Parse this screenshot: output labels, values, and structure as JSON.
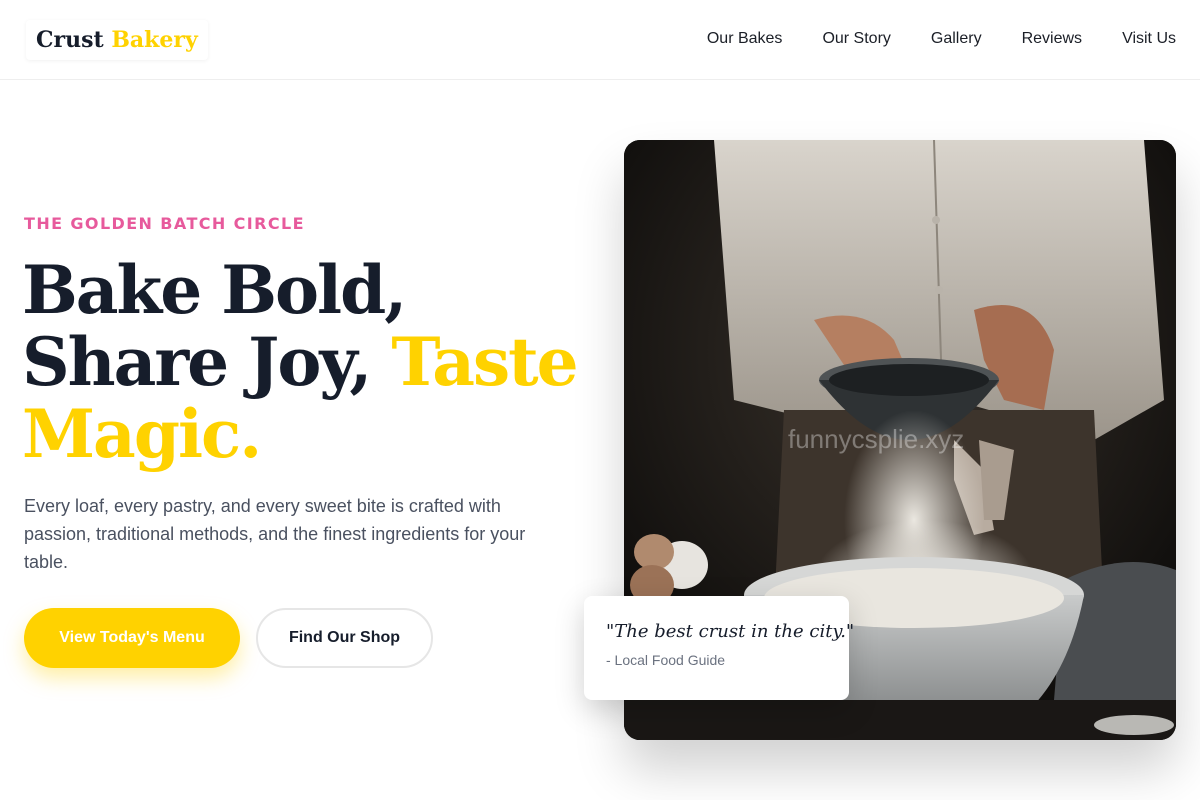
{
  "header": {
    "logo": {
      "part1": "Crust",
      "part2": "Bakery"
    },
    "nav": [
      {
        "label": "Our Bakes"
      },
      {
        "label": "Our Story"
      },
      {
        "label": "Gallery"
      },
      {
        "label": "Reviews"
      },
      {
        "label": "Visit Us"
      }
    ]
  },
  "hero": {
    "eyebrow": "THE GOLDEN BATCH CIRCLE",
    "headline": {
      "line1": "Bake Bold,",
      "line2a": "Share Joy,",
      "line2b": "Taste",
      "line3": "Magic."
    },
    "lede": "Every loaf, every pastry, and every sweet bite is crafted with passion, traditional methods, and the finest ingredients for your table.",
    "primary_cta": "View Today's Menu",
    "secondary_cta": "Find Our Shop",
    "image_watermark": "funnycsplie.xyz",
    "quote": {
      "text": "\"The best crust in the city.\"",
      "source": "- Local Food Guide"
    }
  },
  "colors": {
    "accent": "#ffd200",
    "eyebrow": "#e75a9c",
    "ink": "#161d2b"
  }
}
